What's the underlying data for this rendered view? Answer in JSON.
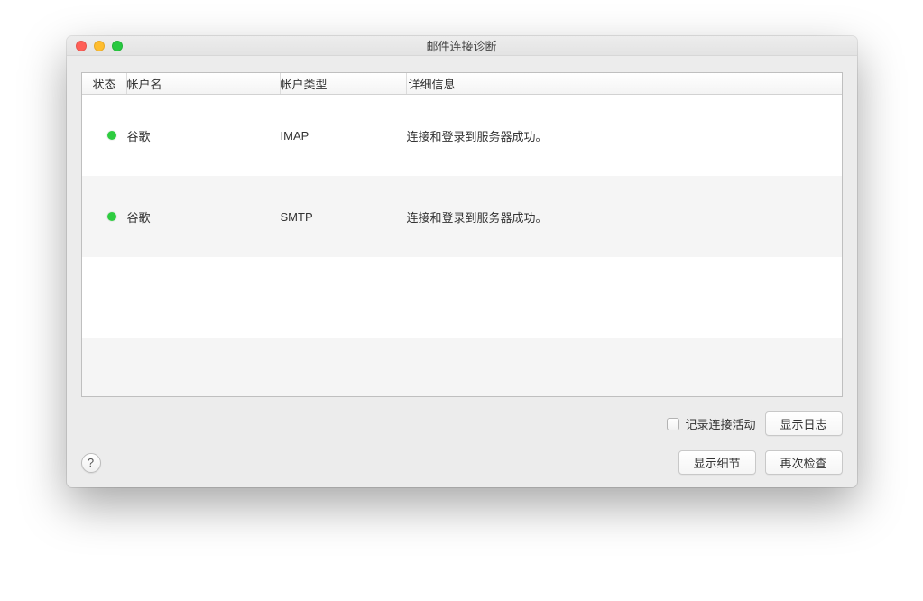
{
  "window": {
    "title": "邮件连接诊断"
  },
  "table": {
    "headers": {
      "status": "状态",
      "account": "帐户名",
      "type": "帐户类型",
      "details": "详细信息"
    },
    "rows": [
      {
        "status_color": "green",
        "account": "谷歌",
        "type": "IMAP",
        "details": "连接和登录到服务器成功。"
      },
      {
        "status_color": "green",
        "account": "谷歌",
        "type": "SMTP",
        "details": "连接和登录到服务器成功。"
      }
    ]
  },
  "footer": {
    "log_checkbox_label": "记录连接活动",
    "show_log_label": "显示日志",
    "show_details_label": "显示细节",
    "check_again_label": "再次检查",
    "help_symbol": "?"
  }
}
